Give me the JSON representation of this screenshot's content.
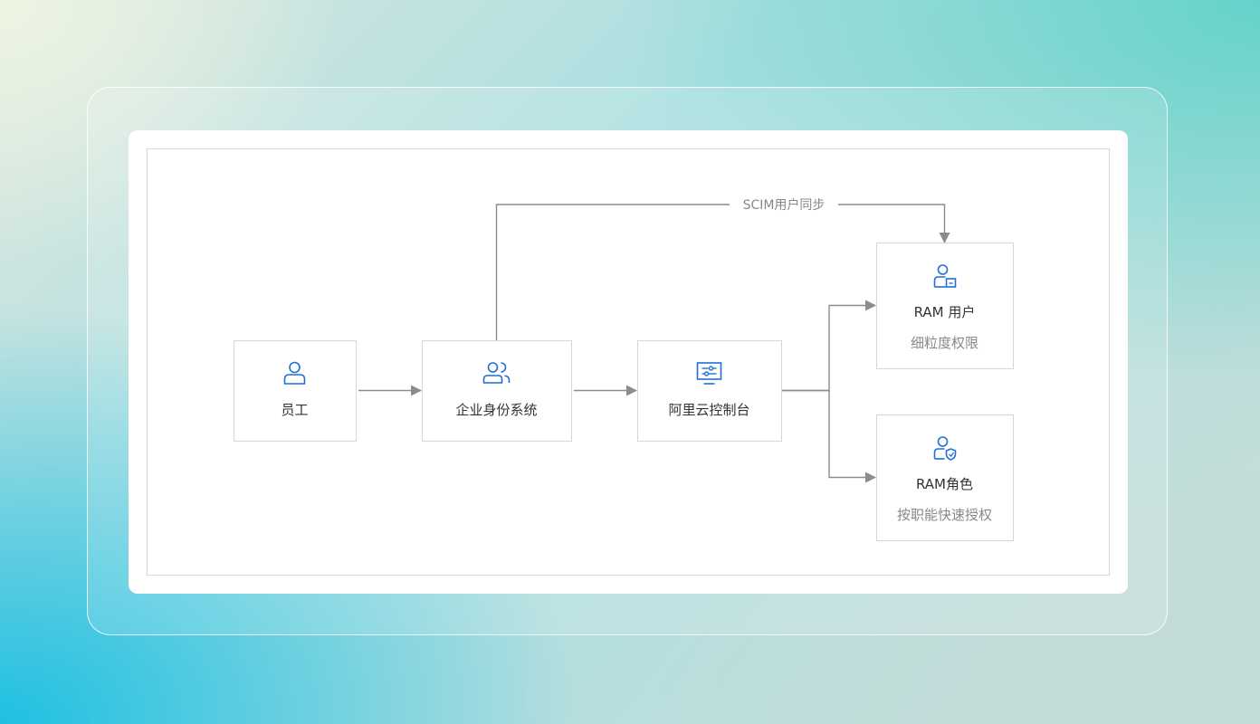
{
  "diagram": {
    "nodes": [
      {
        "id": "employee",
        "label": "员工",
        "icon": "user-icon"
      },
      {
        "id": "idp",
        "label": "企业身份系统",
        "icon": "users-icon"
      },
      {
        "id": "console",
        "label": "阿里云控制台",
        "icon": "console-icon"
      },
      {
        "id": "ram-user",
        "label": "RAM 用户",
        "subtitle": "细粒度权限",
        "icon": "user-card-icon"
      },
      {
        "id": "ram-role",
        "label": "RAM角色",
        "subtitle": "按职能快速授权",
        "icon": "user-shield-icon"
      }
    ],
    "edges": [
      {
        "from": "employee",
        "to": "idp"
      },
      {
        "from": "idp",
        "to": "console"
      },
      {
        "from": "console",
        "to": "ram-user"
      },
      {
        "from": "console",
        "to": "ram-role"
      },
      {
        "from": "idp",
        "to": "ram-user",
        "label": "SCIM用户同步"
      }
    ],
    "colors": {
      "icon": "#1f6fd9",
      "arrow": "#8c8c8c",
      "border": "#d6d6d6",
      "title": "#333333",
      "subtitle": "#888888"
    }
  }
}
